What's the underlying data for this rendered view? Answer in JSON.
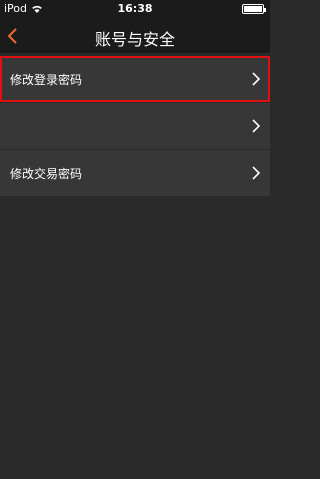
{
  "status": {
    "carrier": "iPod",
    "time": "16:38"
  },
  "nav": {
    "title": "账号与安全",
    "back_icon": "chevron-left-icon"
  },
  "menu": {
    "items": [
      {
        "label": "修改登录密码"
      },
      {
        "label": ""
      },
      {
        "label": "修改交易密码"
      }
    ]
  },
  "colors": {
    "accent": "#f06a35",
    "highlight": "#e01010",
    "background": "#2a2a2a",
    "item": "#373737",
    "bar": "#1b1b1b"
  }
}
